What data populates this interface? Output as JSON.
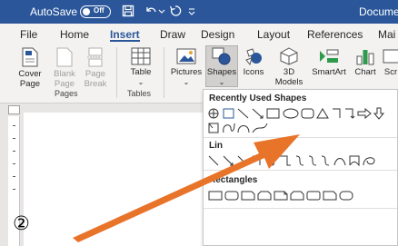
{
  "titlebar": {
    "autosave_label": "AutoSave",
    "autosave_state": "Off",
    "document_title": "Docume"
  },
  "tabs": [
    "File",
    "Home",
    "Insert",
    "Draw",
    "Design",
    "Layout",
    "References",
    "Mai"
  ],
  "active_tab": "Insert",
  "ribbon": {
    "pages_group": {
      "cover_page": "Cover\nPage",
      "blank_page": "Blank\nPage",
      "page_break": "Page\nBreak",
      "label": "Pages"
    },
    "tables_group": {
      "table": "Table",
      "label": "Tables"
    },
    "illustrations_group": {
      "pictures": "Pictures",
      "shapes": "Shapes",
      "icons": "Icons",
      "models_3d": "3D\nModels",
      "smartart": "SmartArt",
      "chart": "Chart",
      "screenshot": "Scr"
    }
  },
  "dropdown": {
    "recently_used_title": "Recently Used Shapes",
    "lines_title": "Lin",
    "rectangles_title": "Rectangles"
  },
  "annotation": {
    "step_number": "②"
  },
  "colors": {
    "word_blue": "#2b579a",
    "ribbon_bg": "#f3f2f1",
    "arrow_orange": "#e8742a"
  }
}
